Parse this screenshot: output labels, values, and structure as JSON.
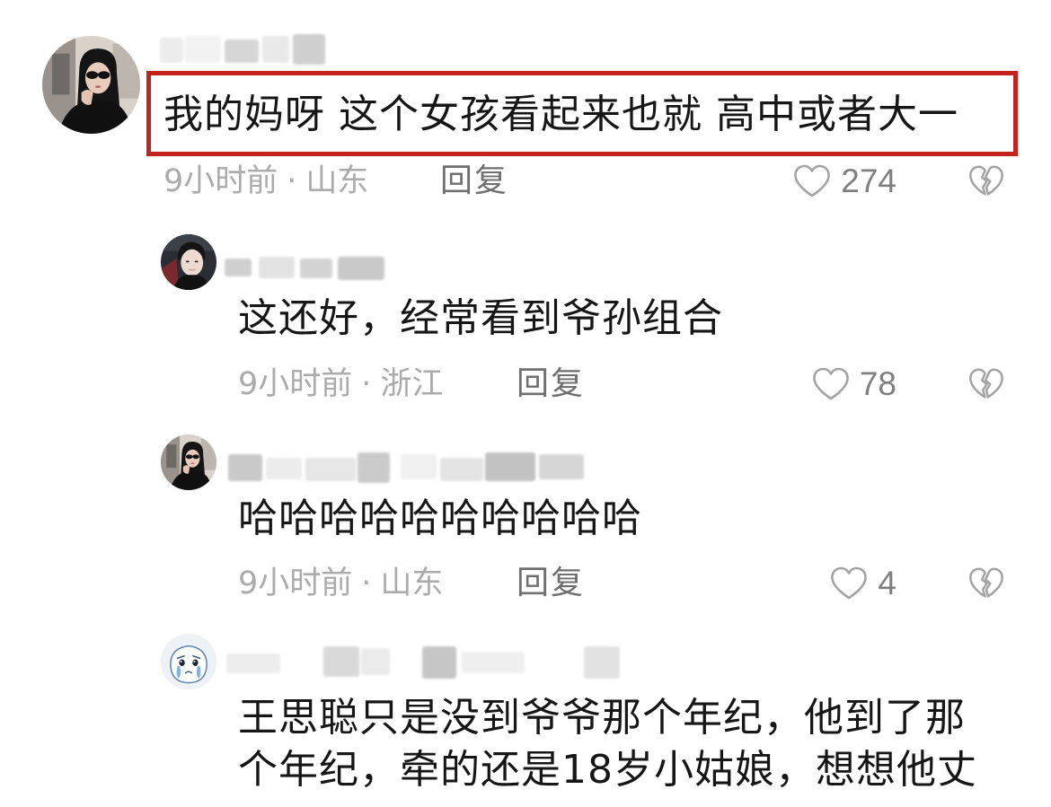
{
  "ui": {
    "reply_label": "回复",
    "meta_separator": "·"
  },
  "colors": {
    "highlight_border": "#c3231f",
    "comment_text": "#161616",
    "meta_text": "#ababab",
    "reply_text": "#6f6f6f",
    "like_count": "#808080",
    "icon_stroke": "#a3a3a3"
  },
  "icons": {
    "like": "heart-outline-icon",
    "dislike": "broken-heart-icon"
  },
  "comments": [
    {
      "highlighted": true,
      "avatar_icon": "woman-sunglasses-avatar",
      "text": "我的妈呀 这个女孩看起来也就 高中或者大一",
      "time": "9小时前",
      "location": "山东",
      "likes": "274"
    },
    {
      "avatar_icon": "man-avatar",
      "text": "这还好，经常看到爷孙组合",
      "time": "9小时前",
      "location": "浙江",
      "likes": "78"
    },
    {
      "avatar_icon": "woman-sunglasses-avatar",
      "text": "哈哈哈哈哈哈哈哈哈哈",
      "time": "9小时前",
      "location": "山东",
      "likes": "4"
    },
    {
      "avatar_icon": "crying-cartoon-avatar",
      "text_lines": [
        "王思聪只是没到爷爷那个年纪，他到了那",
        "个年纪，牵的还是18岁小姑娘，想想他丈"
      ]
    }
  ]
}
